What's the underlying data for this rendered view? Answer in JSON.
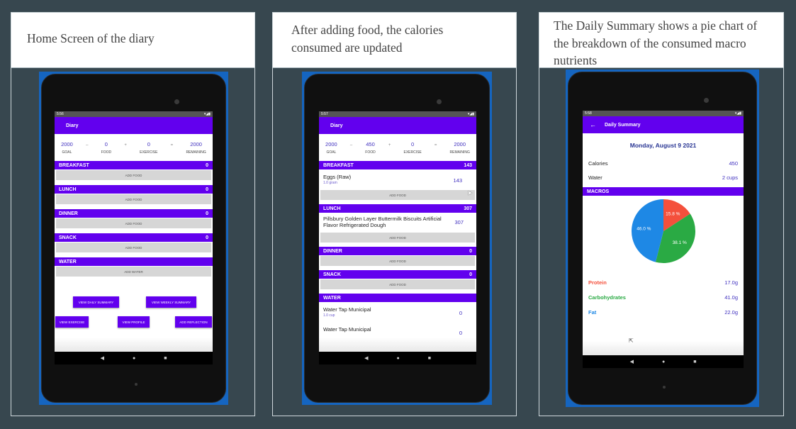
{
  "captions": {
    "home": "Home Screen of the diary",
    "after_food": "After adding food, the calories consumed are updated",
    "daily_summary": "The Daily Summary shows a pie chart of the breakdown of the consumed macro nutrients"
  },
  "home": {
    "status_time": "5:56",
    "title": "Diary",
    "summary": {
      "goal": "2000",
      "goal_label": "GOAL",
      "food": "0",
      "food_label": "FOOD",
      "exercise": "0",
      "exercise_label": "EXERCISE",
      "remaining": "2000",
      "remaining_label": "REMAINING",
      "op1": "–",
      "op2": "+",
      "op3": "="
    },
    "sections": [
      {
        "name": "BREAKFAST",
        "cal": "0",
        "button": "ADD FOOD"
      },
      {
        "name": "LUNCH",
        "cal": "0",
        "button": "ADD FOOD"
      },
      {
        "name": "DINNER",
        "cal": "0",
        "button": "ADD FOOD"
      },
      {
        "name": "SNACK",
        "cal": "0",
        "button": "ADD FOOD"
      },
      {
        "name": "WATER",
        "cal": "",
        "button": "ADD WATER"
      }
    ],
    "buttons": {
      "daily_summary": "VIEW DAILY SUMMARY",
      "weekly_summary": "VIEW WEEKLY SUMMARY",
      "exercise": "VIEW EXERCISE",
      "profile": "VIEW PROFILE",
      "reflection": "ADD REFLECTION"
    }
  },
  "after": {
    "status_time": "5:57",
    "title": "Diary",
    "summary": {
      "goal": "2000",
      "goal_label": "GOAL",
      "food": "450",
      "food_label": "FOOD",
      "exercise": "0",
      "exercise_label": "EXERCISE",
      "remaining": "2000",
      "remaining_label": "REMAINING",
      "op1": "–",
      "op2": "+",
      "op3": "="
    },
    "breakfast": {
      "name": "BREAKFAST",
      "cal": "143",
      "item": "Eggs (Raw)",
      "item_sub": "1.0 gram",
      "item_cal": "143",
      "button": "ADD FOOD"
    },
    "lunch": {
      "name": "LUNCH",
      "cal": "307",
      "item": "Pillsbury Golden Layer Buttermilk Biscuits Artificial Flavor Refrigerated Dough",
      "item_cal": "307",
      "button": "ADD FOOD"
    },
    "dinner": {
      "name": "DINNER",
      "cal": "0",
      "button": "ADD FOOD"
    },
    "snack": {
      "name": "SNACK",
      "cal": "0",
      "button": "ADD FOOD"
    },
    "water": {
      "name": "WATER",
      "item1": "Water Tap Municipal",
      "item1_sub": "1.0 cup",
      "item1_cal": "0",
      "item2": "Water Tap Municipal",
      "item2_cal": "0"
    }
  },
  "daily": {
    "status_time": "5:58",
    "title": "Daily Summary",
    "date": "Monday, August 9 2021",
    "calories_label": "Calories",
    "calories_value": "450",
    "water_label": "Water",
    "water_value": "2 cups",
    "macros_header": "MACROS",
    "macros": [
      {
        "name": "Protein",
        "value": "17.0g",
        "color": "#f4503c"
      },
      {
        "name": "Carbohydrates",
        "value": "41.0g",
        "color": "#2aaa44"
      },
      {
        "name": "Fat",
        "value": "22.0g",
        "color": "#1e88e5"
      }
    ]
  },
  "chart_data": {
    "type": "pie",
    "labels": [
      "Protein",
      "Carbohydrates",
      "Fat"
    ],
    "values": [
      15.8,
      38.1,
      46.0
    ],
    "value_labels": [
      "15.8 %",
      "38.1 %",
      "46.0 %"
    ],
    "colors": [
      "#f4503c",
      "#2aaa44",
      "#1e88e5"
    ]
  }
}
